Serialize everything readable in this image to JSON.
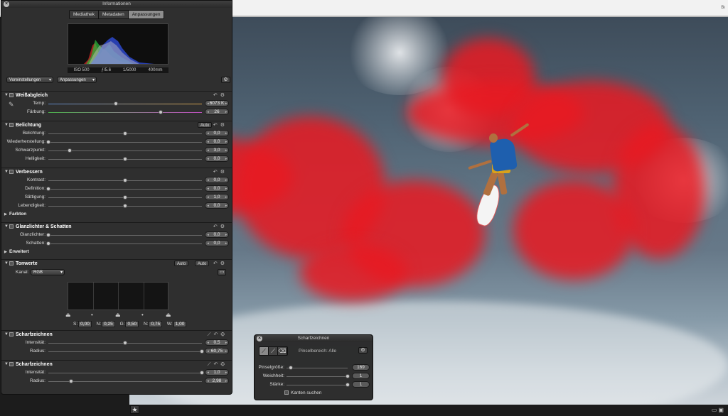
{
  "info_panel": {
    "title": "Informationen",
    "tabs": [
      {
        "label": "Mediathek"
      },
      {
        "label": "Metadaten"
      },
      {
        "label": "Anpassungen"
      }
    ],
    "active_tab": "Anpassungen",
    "exif": {
      "iso": "ISO 500",
      "aperture": "ƒ/5.6",
      "shutter": "1/5000",
      "focal": "400mm"
    },
    "presets_label": "Voreinstellungen",
    "adjustments_label": "Anpassungen"
  },
  "white_balance": {
    "title": "Weißabgleich",
    "temp": {
      "label": "Temp:",
      "value": "6073 K",
      "level": 0.44
    },
    "tint": {
      "label": "Färbung:",
      "value": "26",
      "level": 0.73
    }
  },
  "exposure": {
    "title": "Belichtung",
    "auto_label": "Auto",
    "rows": [
      {
        "label": "Belichtung:",
        "value": "0,0",
        "level": 0.5
      },
      {
        "label": "Wiederherstellung:",
        "value": "0,0",
        "level": 0.0
      },
      {
        "label": "Schwarzpunkt:",
        "value": "3,0",
        "level": 0.14
      },
      {
        "label": "Helligkeit:",
        "value": "0,0",
        "level": 0.5
      }
    ]
  },
  "enhance": {
    "title": "Verbessern",
    "rows": [
      {
        "label": "Kontrast:",
        "value": "0,0",
        "level": 0.5
      },
      {
        "label": "Definition:",
        "value": "0,0",
        "level": 0.0
      },
      {
        "label": "Sättigung:",
        "value": "1,0",
        "level": 0.5
      },
      {
        "label": "Lebendigkeit:",
        "value": "0,0",
        "level": 0.5
      }
    ],
    "sub_label": "Farbton"
  },
  "highlights_shadows": {
    "title": "Glanzlichter & Schatten",
    "rows": [
      {
        "label": "Glanzlichter:",
        "value": "0,0",
        "level": 0.0
      },
      {
        "label": "Schatten:",
        "value": "0,0",
        "level": 0.0
      }
    ],
    "sub_label": "Erweitert"
  },
  "levels": {
    "title": "Tonwerte",
    "auto_label_1": "Auto",
    "auto_label_2": "Auto",
    "channel_label": "Kanal:",
    "channel_value": "RGB",
    "fields": [
      {
        "label": "S:",
        "value": "0,00"
      },
      {
        "label": "N:",
        "value": "0,25"
      },
      {
        "label": "G:",
        "value": "0,50"
      },
      {
        "label": "N:",
        "value": "0,75"
      },
      {
        "label": "W:",
        "value": "1,00"
      }
    ]
  },
  "sharpen_1": {
    "title": "Scharfzeichnen",
    "rows": [
      {
        "label": "Intensität:",
        "value": "0,5",
        "level": 0.5
      },
      {
        "label": "Radius:",
        "value": "60,75",
        "level": 1.0
      }
    ]
  },
  "sharpen_2": {
    "title": "Scharfzeichnen",
    "rows": [
      {
        "label": "Intensität:",
        "value": "1,0",
        "level": 1.0
      },
      {
        "label": "Radius:",
        "value": "2,98",
        "level": 0.15
      }
    ]
  },
  "brush_hud": {
    "title": "Scharfzeichnen",
    "brush_range": "Pinselbereich: Alle",
    "rows": [
      {
        "label": "Pinselgröße:",
        "value": "169",
        "level": 0.07
      },
      {
        "label": "Weichheit:",
        "value": "1",
        "level": 1.0
      },
      {
        "label": "Stärke:",
        "value": "1",
        "level": 1.0
      }
    ],
    "edge_detect_label": "Kanten suchen"
  },
  "window_title_fragment": "Bı",
  "colors": {
    "mask": "#e81a22",
    "panel": "#2f2f2f",
    "accent": "#8e8e8e"
  },
  "icons": [
    "close-icon",
    "gear-icon",
    "reset-icon",
    "eyedropper-icon",
    "brush-icon",
    "star-icon"
  ]
}
